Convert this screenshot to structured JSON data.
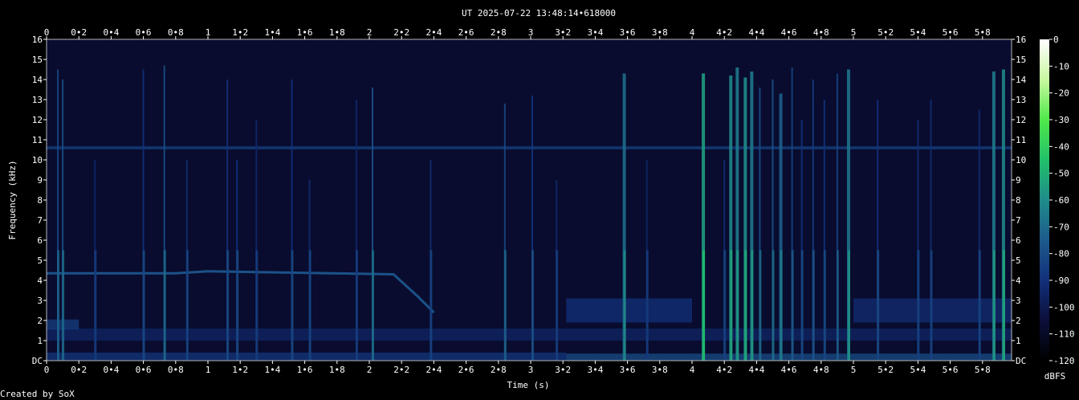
{
  "chart_data": {
    "type": "heatmap",
    "title": "UT 2025-07-22 13:48:14•618000",
    "xlabel": "Time (s)",
    "ylabel": "Frequency (kHz)",
    "credit": "Created by SoX",
    "xlim": [
      0,
      5.98
    ],
    "ylim": [
      0,
      16
    ],
    "x_ticks": [
      "0",
      "0•2",
      "0•4",
      "0•6",
      "0•8",
      "1",
      "1•2",
      "1•4",
      "1•6",
      "1•8",
      "2",
      "2•2",
      "2•4",
      "2•6",
      "2•8",
      "3",
      "3•2",
      "3•4",
      "3•6",
      "3•8",
      "4",
      "4•2",
      "4•4",
      "4•6",
      "4•8",
      "5",
      "5•2",
      "5•4",
      "5•6",
      "5•8"
    ],
    "x_tick_values": [
      0,
      0.2,
      0.4,
      0.6,
      0.8,
      1,
      1.2,
      1.4,
      1.6,
      1.8,
      2,
      2.2,
      2.4,
      2.6,
      2.8,
      3,
      3.2,
      3.4,
      3.6,
      3.8,
      4,
      4.2,
      4.4,
      4.6,
      4.8,
      5,
      5.2,
      5.4,
      5.6,
      5.8
    ],
    "y_ticks": [
      "DC",
      "1",
      "2",
      "3",
      "4",
      "5",
      "6",
      "7",
      "8",
      "9",
      "10",
      "11",
      "12",
      "13",
      "14",
      "15",
      "16"
    ],
    "colorbar": {
      "label": "dBFS",
      "ticks": [
        "0",
        "-10",
        "-20",
        "-30",
        "-40",
        "-50",
        "-60",
        "-70",
        "-80",
        "-90",
        "-100",
        "-110",
        "-120"
      ],
      "range": [
        -120,
        0
      ],
      "colors": [
        "#000000",
        "#0b0f3a",
        "#12307a",
        "#1d5a8c",
        "#1f8c8a",
        "#22c06a",
        "#50e84a",
        "#c8f8a0",
        "#ffffff"
      ]
    },
    "background_dbfs": -108,
    "bands": [
      {
        "t0": 0.0,
        "t1": 3.22,
        "f": 0.15,
        "df": 0.5,
        "db": -88
      },
      {
        "t0": 3.22,
        "t1": 5.98,
        "f": 0.15,
        "df": 0.4,
        "db": -80
      },
      {
        "t0": 0.0,
        "t1": 5.98,
        "f": 1.3,
        "df": 0.6,
        "db": -95
      },
      {
        "t0": 3.22,
        "t1": 4.0,
        "f": 2.5,
        "df": 1.2,
        "db": -90
      },
      {
        "t0": 5.0,
        "t1": 5.98,
        "f": 2.5,
        "df": 1.2,
        "db": -92
      },
      {
        "t0": 0.0,
        "t1": 0.2,
        "f": 1.8,
        "df": 0.5,
        "db": -85
      },
      {
        "t0": 0.0,
        "t1": 5.98,
        "f": 10.6,
        "df": 0.15,
        "db": -84
      }
    ],
    "chirp": {
      "points": [
        [
          0.0,
          4.35
        ],
        [
          0.8,
          4.35
        ],
        [
          1.0,
          4.45
        ],
        [
          2.15,
          4.3
        ],
        [
          2.3,
          3.2
        ],
        [
          2.4,
          2.4
        ]
      ],
      "db": -78
    },
    "clicks": [
      {
        "t": 0.07,
        "db": -82,
        "top": 14.5
      },
      {
        "t": 0.1,
        "db": -80,
        "top": 14.0
      },
      {
        "t": 0.3,
        "db": -95,
        "top": 10
      },
      {
        "t": 0.6,
        "db": -90,
        "top": 14.5
      },
      {
        "t": 0.73,
        "db": -80,
        "top": 14.7
      },
      {
        "t": 0.87,
        "db": -92,
        "top": 10
      },
      {
        "t": 1.12,
        "db": -90,
        "top": 14
      },
      {
        "t": 1.18,
        "db": -90,
        "top": 10
      },
      {
        "t": 1.3,
        "db": -94,
        "top": 12
      },
      {
        "t": 1.52,
        "db": -90,
        "top": 14
      },
      {
        "t": 1.63,
        "db": -92,
        "top": 9
      },
      {
        "t": 1.92,
        "db": -94,
        "top": 13
      },
      {
        "t": 2.02,
        "db": -78,
        "top": 13.6
      },
      {
        "t": 2.38,
        "db": -92,
        "top": 10
      },
      {
        "t": 2.84,
        "db": -82,
        "top": 12.8
      },
      {
        "t": 3.01,
        "db": -88,
        "top": 13.2
      },
      {
        "t": 3.16,
        "db": -94,
        "top": 9
      },
      {
        "t": 3.58,
        "db": -70,
        "top": 14.3
      },
      {
        "t": 3.72,
        "db": -95,
        "top": 10
      },
      {
        "t": 4.07,
        "db": -55,
        "top": 14.3
      },
      {
        "t": 4.2,
        "db": -92,
        "top": 10
      },
      {
        "t": 4.24,
        "db": -62,
        "top": 14.2
      },
      {
        "t": 4.28,
        "db": -66,
        "top": 14.6
      },
      {
        "t": 4.33,
        "db": -60,
        "top": 14.1
      },
      {
        "t": 4.37,
        "db": -66,
        "top": 14.4
      },
      {
        "t": 4.42,
        "db": -80,
        "top": 13.6
      },
      {
        "t": 4.5,
        "db": -78,
        "top": 14
      },
      {
        "t": 4.55,
        "db": -74,
        "top": 13.3
      },
      {
        "t": 4.62,
        "db": -84,
        "top": 14.6
      },
      {
        "t": 4.68,
        "db": -90,
        "top": 12
      },
      {
        "t": 4.75,
        "db": -86,
        "top": 14
      },
      {
        "t": 4.82,
        "db": -90,
        "top": 13
      },
      {
        "t": 4.9,
        "db": -84,
        "top": 14.3
      },
      {
        "t": 4.97,
        "db": -68,
        "top": 14.5
      },
      {
        "t": 5.15,
        "db": -90,
        "top": 13
      },
      {
        "t": 5.4,
        "db": -92,
        "top": 12
      },
      {
        "t": 5.48,
        "db": -92,
        "top": 13
      },
      {
        "t": 5.78,
        "db": -92,
        "top": 12.5
      },
      {
        "t": 5.87,
        "db": -66,
        "top": 14.4
      },
      {
        "t": 5.93,
        "db": -62,
        "top": 14.5
      }
    ]
  }
}
